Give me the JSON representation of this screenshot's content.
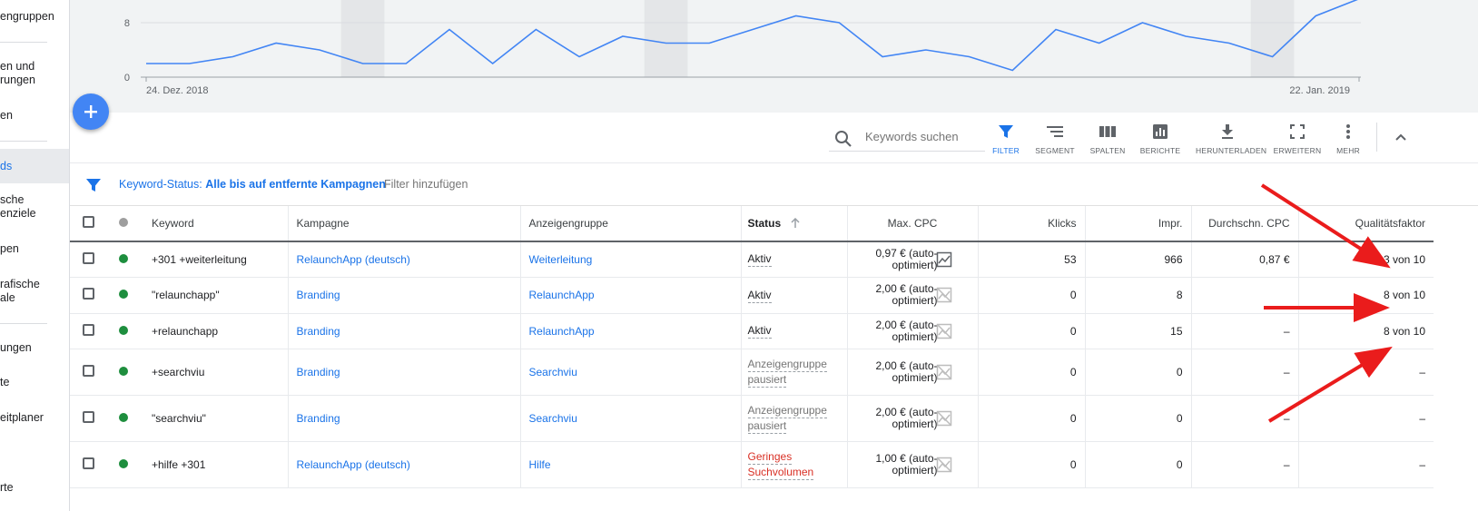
{
  "sidebar": {
    "items": [
      {
        "label": "engruppen"
      },
      {
        "label": "en und\nrungen"
      },
      {
        "label": "en"
      },
      {
        "label": "ds"
      },
      {
        "label": "sche\nenziele"
      },
      {
        "label": "pen"
      },
      {
        "label": "rafische\nale"
      },
      {
        "label": "ungen"
      },
      {
        "label": "te"
      },
      {
        "label": "eitplaner"
      },
      {
        "label": "rte"
      }
    ]
  },
  "chart": {
    "y_ticks": [
      "8",
      "0"
    ],
    "x_start_label": "24. Dez. 2018",
    "x_end_label": "22. Jan. 2019",
    "line_color": "#4285f4"
  },
  "chart_data": {
    "type": "line",
    "title": "",
    "xlabel": "",
    "ylabel": "",
    "x_start": "2018-12-24",
    "x_end": "2019-01-22",
    "ylim": [
      0,
      13
    ],
    "y_ticks": [
      0,
      8
    ],
    "series": [
      {
        "values": [
          2,
          2,
          3,
          5,
          4,
          2,
          2,
          7,
          2,
          7,
          3,
          6,
          5,
          5,
          7,
          9,
          8,
          3,
          4,
          3,
          1,
          7,
          5,
          8,
          6,
          5,
          3,
          9,
          11.5
        ]
      }
    ],
    "weekend_bands": true
  },
  "toolbar": {
    "search_placeholder": "Keywords suchen",
    "tools": [
      {
        "label": "FILTER",
        "icon": "filter-icon",
        "active": true
      },
      {
        "label": "SEGMENT",
        "icon": "segment-icon",
        "active": false
      },
      {
        "label": "SPALTEN",
        "icon": "columns-icon",
        "active": false
      },
      {
        "label": "BERICHTE",
        "icon": "reports-icon",
        "active": false
      },
      {
        "label": "HERUNTERLADEN",
        "icon": "download-icon",
        "active": false
      },
      {
        "label": "ERWEITERN",
        "icon": "expand-icon",
        "active": false
      },
      {
        "label": "MEHR",
        "icon": "more-icon",
        "active": false
      }
    ]
  },
  "filter": {
    "key": "Keyword-Status:",
    "value": "Alle bis auf entfernte Kampagnen",
    "add": "Filter hinzufügen"
  },
  "table": {
    "headers": {
      "keyword": "Keyword",
      "campaign": "Kampagne",
      "adgroup": "Anzeigengruppe",
      "status": "Status",
      "maxcpc": "Max. CPC",
      "clicks": "Klicks",
      "impr": "Impr.",
      "avgcpc": "Durchschn. CPC",
      "quality": "Qualitätsfaktor"
    },
    "rows": [
      {
        "keyword": "+301 +weiterleitung",
        "campaign": "RelaunchApp (deutsch)",
        "adgroup": "Weiterleitung",
        "status": "Aktiv",
        "status_type": "active",
        "cpc1": "0,97 € (auto-",
        "cpc2": "optimiert)",
        "clicks": "53",
        "impr": "966",
        "avgcpc": "0,87 €",
        "quality": "3 von 10"
      },
      {
        "keyword": "\"relaunchapp\"",
        "campaign": "Branding",
        "adgroup": "RelaunchApp",
        "status": "Aktiv",
        "status_type": "active",
        "cpc1": "2,00 € (auto-",
        "cpc2": "optimiert)",
        "clicks": "0",
        "impr": "8",
        "avgcpc": "",
        "quality": "8 von 10"
      },
      {
        "keyword": "+relaunchapp",
        "campaign": "Branding",
        "adgroup": "RelaunchApp",
        "status": "Aktiv",
        "status_type": "active",
        "cpc1": "2,00 € (auto-",
        "cpc2": "optimiert)",
        "clicks": "0",
        "impr": "15",
        "avgcpc": "–",
        "quality": "8 von 10"
      },
      {
        "keyword": "+searchviu",
        "campaign": "Branding",
        "adgroup": "Searchviu",
        "status": "Anzeigengruppe",
        "status2": "pausiert",
        "status_type": "paused",
        "cpc1": "2,00 € (auto-",
        "cpc2": "optimiert)",
        "clicks": "0",
        "impr": "0",
        "avgcpc": "–",
        "quality": "–"
      },
      {
        "keyword": "\"searchviu\"",
        "campaign": "Branding",
        "adgroup": "Searchviu",
        "status": "Anzeigengruppe",
        "status2": "pausiert",
        "status_type": "paused",
        "cpc1": "2,00 € (auto-",
        "cpc2": "optimiert)",
        "clicks": "0",
        "impr": "0",
        "avgcpc": "–",
        "quality": "–"
      },
      {
        "keyword": "+hilfe +301",
        "campaign": "RelaunchApp (deutsch)",
        "adgroup": "Hilfe",
        "status": "Geringes",
        "status2": "Suchvolumen",
        "status_type": "low",
        "cpc1": "1,00 € (auto-",
        "cpc2": "optimiert)",
        "clicks": "0",
        "impr": "0",
        "avgcpc": "–",
        "quality": "–"
      }
    ]
  },
  "colors": {
    "accent": "#1a73e8",
    "status_green": "#1e8e3e",
    "arrow": "#ea1c1c",
    "warning": "#d93025"
  }
}
